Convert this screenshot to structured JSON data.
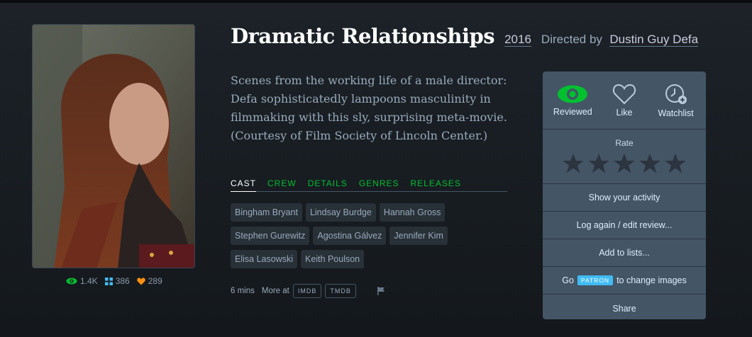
{
  "film": {
    "title": "Dramatic Relationships",
    "year": "2016",
    "directed_by": "Directed by",
    "director": "Dustin Guy Defa",
    "synopsis": "Scenes from the working life of a male director: Defa sophisticatedly lampoons masculinity in filmmaking with this sly, surprising meta-movie. (Courtesy of Film Society of Lincoln Center.)"
  },
  "stats": {
    "watched": "1.4K",
    "lists": "386",
    "likes": "289"
  },
  "tabs": [
    "CAST",
    "CREW",
    "DETAILS",
    "GENRES",
    "RELEASES"
  ],
  "cast": [
    "Bingham Bryant",
    "Lindsay Burdge",
    "Hannah Gross",
    "Stephen Gurewitz",
    "Agostina Gálvez",
    "Jennifer Kim",
    "Elisa Lasowski",
    "Keith Poulson"
  ],
  "meta": {
    "runtime": "6 mins",
    "more_at": "More at",
    "imdb": "IMDB",
    "tmdb": "TMDB"
  },
  "panel": {
    "reviewed": "Reviewed",
    "like": "Like",
    "watchlist": "Watchlist",
    "rate": "Rate",
    "show_activity": "Show your activity",
    "log_again": "Log again / edit review...",
    "add_to_lists": "Add to lists...",
    "go": "Go",
    "patron": "PATRON",
    "change_images": "to change images",
    "share": "Share"
  },
  "colors": {
    "green": "#00c030",
    "orange": "#ff9010",
    "blue": "#40bcf4",
    "panel": "#445566"
  }
}
